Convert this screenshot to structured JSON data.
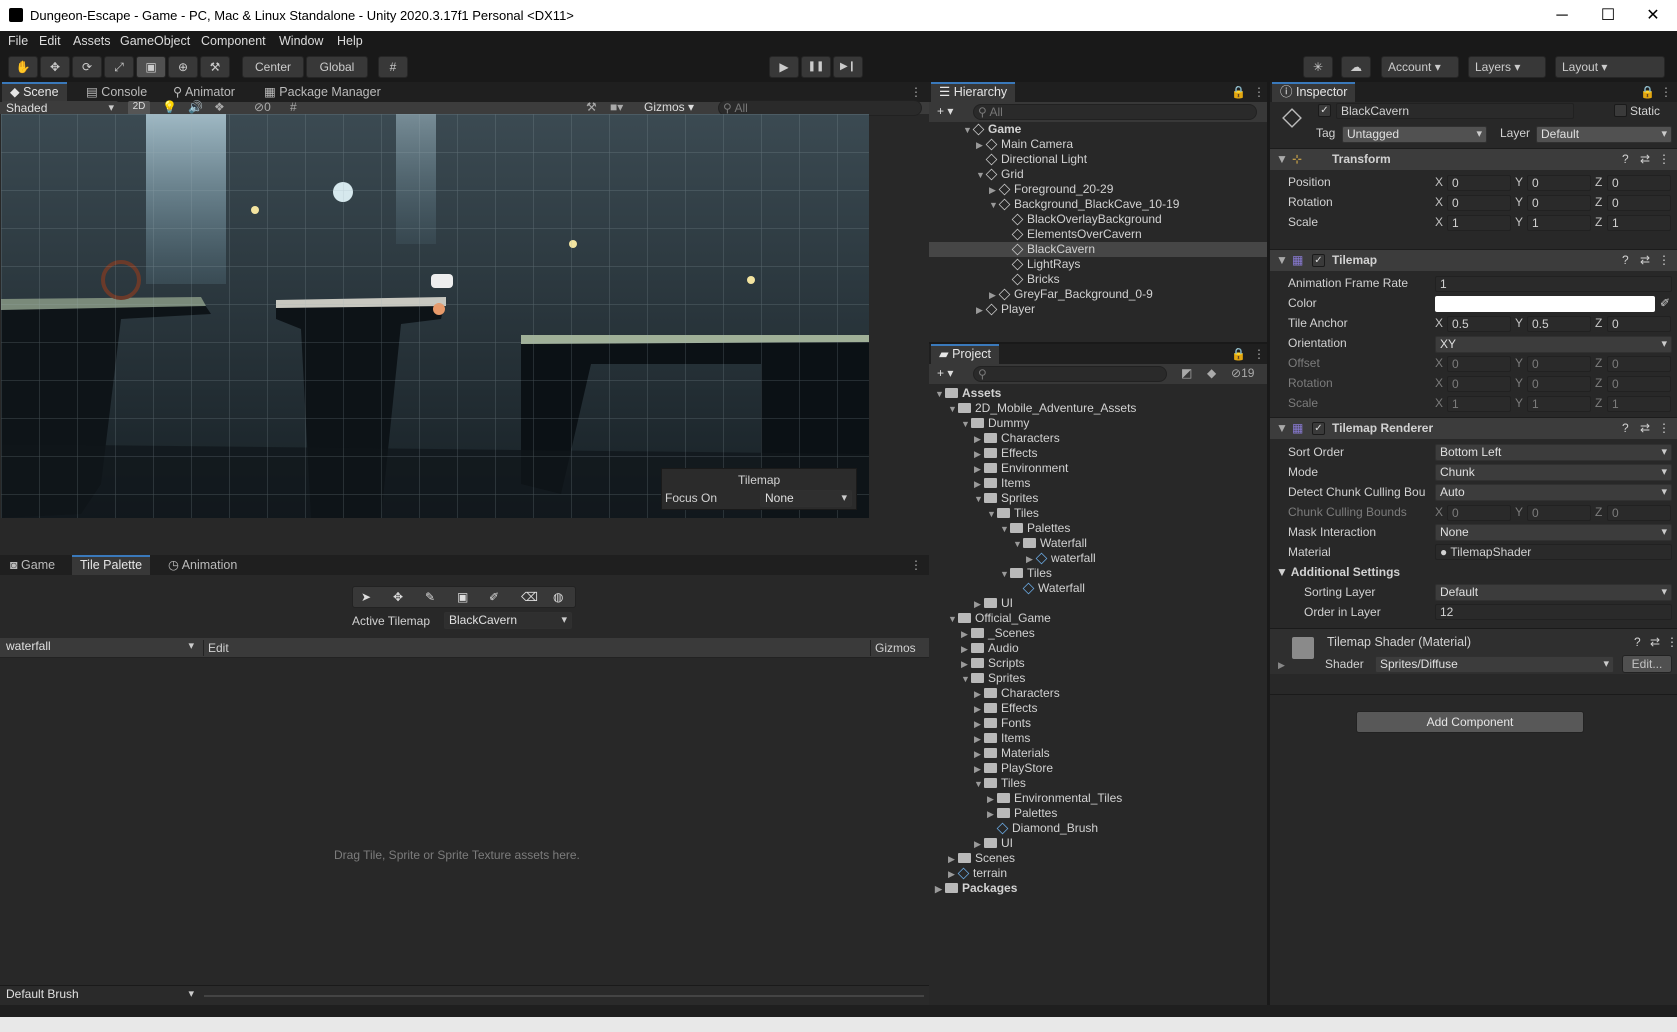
{
  "window": {
    "title": "Dungeon-Escape - Game - PC, Mac & Linux Standalone - Unity 2020.3.17f1 Personal <DX11>",
    "min": "─",
    "max": "☐",
    "close": "✕"
  },
  "menu": [
    "File",
    "Edit",
    "Assets",
    "GameObject",
    "Component",
    "Window",
    "Help"
  ],
  "toolbar": {
    "center": "Center",
    "global": "Global",
    "account": "Account",
    "layers": "Layers",
    "layout": "Layout",
    "play": "▶",
    "pause": "❚❚",
    "step": "▶❙"
  },
  "scene_panel": {
    "tabs": [
      "Scene",
      "Console",
      "Animator",
      "Package Manager"
    ],
    "shading": "Shaded",
    "mode2d": "2D",
    "hidden_count": "0",
    "gizmos": "Gizmos",
    "search_placeholder": "All",
    "overlay": {
      "title": "Tilemap",
      "focus_label": "Focus On",
      "focus_value": "None"
    }
  },
  "palette_panel": {
    "tabs": [
      "Game",
      "Tile Palette",
      "Animation"
    ],
    "active_tilemap_label": "Active Tilemap",
    "active_tilemap": "BlackCavern",
    "palette": "waterfall",
    "edit": "Edit",
    "gizmos": "Gizmos",
    "drop_hint": "Drag Tile, Sprite or Sprite Texture assets here.",
    "brush": "Default Brush"
  },
  "hierarchy": {
    "title": "Hierarchy",
    "search_placeholder": "All",
    "items": [
      {
        "label": "Game",
        "d": 0,
        "f": "open",
        "bold": true
      },
      {
        "label": "Main Camera",
        "d": 1,
        "f": "closed"
      },
      {
        "label": "Directional Light",
        "d": 1,
        "f": ""
      },
      {
        "label": "Grid",
        "d": 1,
        "f": "open"
      },
      {
        "label": "Foreground_20-29",
        "d": 2,
        "f": "closed"
      },
      {
        "label": "Background_BlackCave_10-19",
        "d": 2,
        "f": "open"
      },
      {
        "label": "BlackOverlayBackground",
        "d": 3,
        "f": ""
      },
      {
        "label": "ElementsOverCavern",
        "d": 3,
        "f": ""
      },
      {
        "label": "BlackCavern",
        "d": 3,
        "f": "",
        "sel": true
      },
      {
        "label": "LightRays",
        "d": 3,
        "f": ""
      },
      {
        "label": "Bricks",
        "d": 3,
        "f": ""
      },
      {
        "label": "GreyFar_Background_0-9",
        "d": 2,
        "f": "closed"
      },
      {
        "label": "Player",
        "d": 1,
        "f": "closed"
      }
    ]
  },
  "project": {
    "title": "Project",
    "hidden": "19",
    "items": [
      {
        "label": "Assets",
        "d": 0,
        "f": "open",
        "bold": true
      },
      {
        "label": "2D_Mobile_Adventure_Assets",
        "d": 1,
        "f": "open"
      },
      {
        "label": "Dummy",
        "d": 2,
        "f": "open"
      },
      {
        "label": "Characters",
        "d": 3,
        "f": "closed"
      },
      {
        "label": "Effects",
        "d": 3,
        "f": "closed"
      },
      {
        "label": "Environment",
        "d": 3,
        "f": "closed"
      },
      {
        "label": "Items",
        "d": 3,
        "f": "closed"
      },
      {
        "label": "Sprites",
        "d": 3,
        "f": "open"
      },
      {
        "label": "Tiles",
        "d": 4,
        "f": "open"
      },
      {
        "label": "Palettes",
        "d": 5,
        "f": "open"
      },
      {
        "label": "Waterfall",
        "d": 6,
        "f": "open"
      },
      {
        "label": "waterfall",
        "d": 7,
        "f": "closed",
        "asset": true
      },
      {
        "label": "Tiles",
        "d": 5,
        "f": "open"
      },
      {
        "label": "Waterfall",
        "d": 6,
        "f": "",
        "asset": true
      },
      {
        "label": "UI",
        "d": 3,
        "f": "closed"
      },
      {
        "label": "Official_Game",
        "d": 1,
        "f": "open"
      },
      {
        "label": "_Scenes",
        "d": 2,
        "f": "closed"
      },
      {
        "label": "Audio",
        "d": 2,
        "f": "closed"
      },
      {
        "label": "Scripts",
        "d": 2,
        "f": "closed"
      },
      {
        "label": "Sprites",
        "d": 2,
        "f": "open"
      },
      {
        "label": "Characters",
        "d": 3,
        "f": "closed"
      },
      {
        "label": "Effects",
        "d": 3,
        "f": "closed"
      },
      {
        "label": "Fonts",
        "d": 3,
        "f": "closed"
      },
      {
        "label": "Items",
        "d": 3,
        "f": "closed"
      },
      {
        "label": "Materials",
        "d": 3,
        "f": "closed"
      },
      {
        "label": "PlayStore",
        "d": 3,
        "f": "closed"
      },
      {
        "label": "Tiles",
        "d": 3,
        "f": "open"
      },
      {
        "label": "Environmental_Tiles",
        "d": 4,
        "f": "closed"
      },
      {
        "label": "Palettes",
        "d": 4,
        "f": "closed"
      },
      {
        "label": "Diamond_Brush",
        "d": 4,
        "f": "",
        "asset": true
      },
      {
        "label": "UI",
        "d": 3,
        "f": "closed"
      },
      {
        "label": "Scenes",
        "d": 1,
        "f": "closed"
      },
      {
        "label": "terrain",
        "d": 1,
        "f": "closed",
        "asset": true
      },
      {
        "label": "Packages",
        "d": 0,
        "f": "closed",
        "bold": true
      }
    ]
  },
  "inspector": {
    "title": "Inspector",
    "object_name": "BlackCavern",
    "static": "Static",
    "tag_label": "Tag",
    "tag": "Untagged",
    "layer_label": "Layer",
    "layer": "Default",
    "transform": {
      "title": "Transform",
      "position_label": "Position",
      "rotation_label": "Rotation",
      "scale_label": "Scale",
      "position": [
        "0",
        "0",
        "0"
      ],
      "rotation": [
        "0",
        "0",
        "0"
      ],
      "scale": [
        "1",
        "1",
        "1"
      ]
    },
    "tilemap": {
      "title": "Tilemap",
      "frame_rate_label": "Animation Frame Rate",
      "frame_rate": "1",
      "color_label": "Color",
      "anchor_label": "Tile Anchor",
      "anchor": [
        "0.5",
        "0.5",
        "0"
      ],
      "orientation_label": "Orientation",
      "orientation": "XY",
      "offset_label": "Offset",
      "offset": [
        "0",
        "0",
        "0"
      ],
      "rotation_label": "Rotation",
      "rotation": [
        "0",
        "0",
        "0"
      ],
      "scale_label": "Scale",
      "scale": [
        "1",
        "1",
        "1"
      ]
    },
    "renderer": {
      "title": "Tilemap Renderer",
      "sort_label": "Sort Order",
      "sort": "Bottom Left",
      "mode_label": "Mode",
      "mode": "Chunk",
      "culling_label": "Detect Chunk Culling Bou",
      "culling": "Auto",
      "bounds_label": "Chunk Culling Bounds",
      "bounds": [
        "0",
        "0",
        "0"
      ],
      "mask_label": "Mask Interaction",
      "mask": "None",
      "material_label": "Material",
      "material": "TilemapShader",
      "additional": "Additional Settings",
      "sorting_layer_label": "Sorting Layer",
      "sorting_layer": "Default",
      "order_label": "Order in Layer",
      "order": "12"
    },
    "material": {
      "title": "Tilemap Shader (Material)",
      "shader_label": "Shader",
      "shader": "Sprites/Diffuse",
      "edit": "Edit..."
    },
    "add_component": "Add Component"
  },
  "axes": [
    "X",
    "Y",
    "Z"
  ]
}
